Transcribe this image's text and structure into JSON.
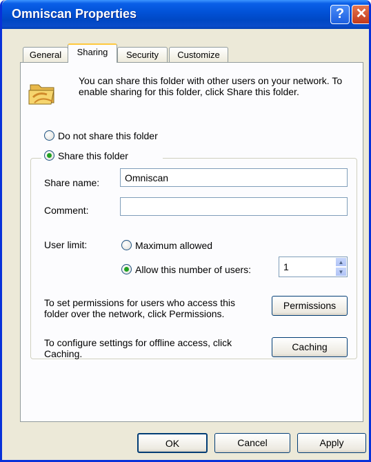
{
  "window": {
    "title": "Omniscan Properties",
    "help_glyph": "?",
    "close_glyph": "✕"
  },
  "tabs": [
    {
      "label": "General"
    },
    {
      "label": "Sharing"
    },
    {
      "label": "Security"
    },
    {
      "label": "Customize"
    }
  ],
  "active_tab": "Sharing",
  "sharing": {
    "intro": "You can share this folder with other users on your network.  To enable sharing for this folder, click Share this folder.",
    "do_not_share_label": "Do not share this folder",
    "share_label": "Share this folder",
    "share_selected": true,
    "share_name_label": "Share name:",
    "share_name_value": "Omniscan",
    "comment_label": "Comment:",
    "comment_value": "",
    "user_limit_label": "User limit:",
    "maximum_allowed_label": "Maximum allowed",
    "allow_number_label": "Allow this number of users:",
    "allow_number_selected": true,
    "allow_number_value": "1",
    "permissions_text": "To set permissions for users who access this folder over the network, click Permissions.",
    "permissions_button": "Permissions",
    "caching_text": "To configure settings for offline access, click Caching.",
    "caching_button": "Caching"
  },
  "footer": {
    "ok": "OK",
    "cancel": "Cancel",
    "apply": "Apply"
  },
  "colors": {
    "title_bar": "#0253d8",
    "active_tab_highlight": "#ffc83c",
    "radio_dot": "#21a121"
  },
  "icons": {
    "folder": "folder-share-icon",
    "spin_up": "chevron-up-icon",
    "spin_down": "chevron-down-icon"
  }
}
